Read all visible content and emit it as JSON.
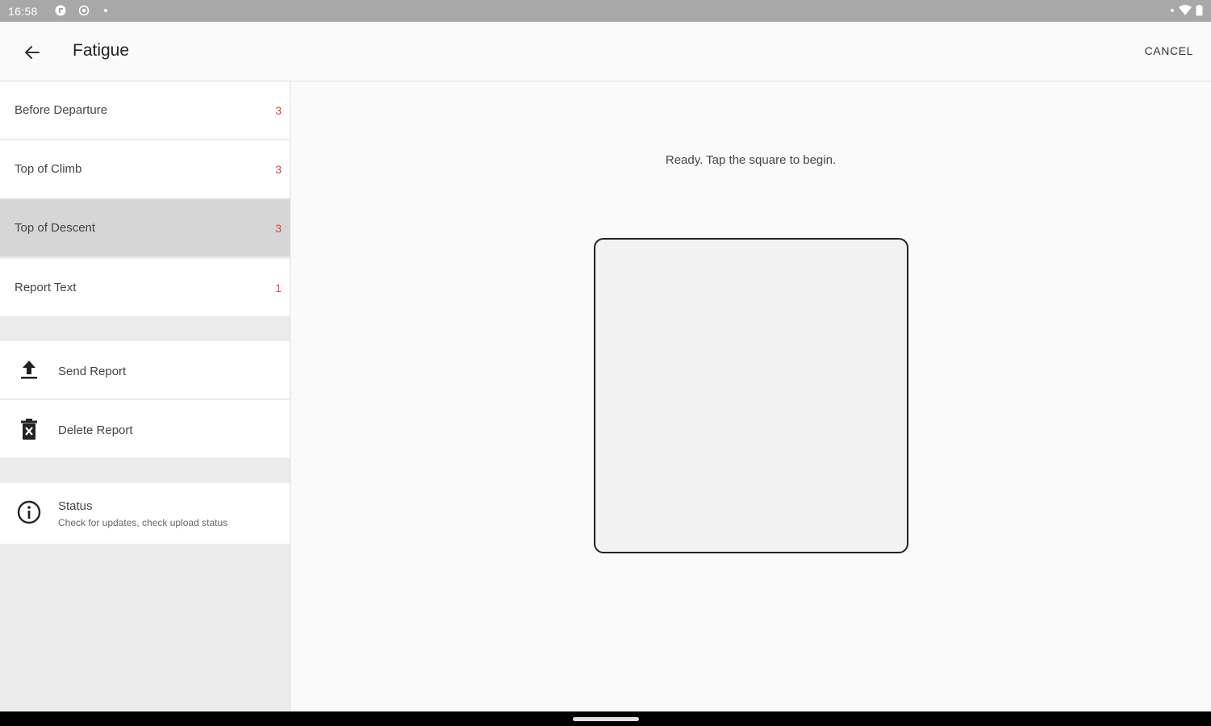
{
  "status_bar": {
    "time": "16:58",
    "icons": [
      "app-icon",
      "settings-circle-icon",
      "dot-icon",
      "wifi-icon",
      "battery-icon"
    ]
  },
  "app_bar": {
    "title": "Fatigue",
    "cancel_label": "CANCEL"
  },
  "sidebar": {
    "items": [
      {
        "label": "Before Departure",
        "count": "3"
      },
      {
        "label": "Top of Climb",
        "count": "3"
      },
      {
        "label": "Top of Descent",
        "count": "3"
      },
      {
        "label": "Report Text",
        "count": "1"
      }
    ],
    "actions": [
      {
        "label": "Send Report",
        "icon": "upload-icon"
      },
      {
        "label": "Delete Report",
        "icon": "delete-icon"
      }
    ],
    "status": {
      "label": "Status",
      "subtitle": "Check for updates, check upload status",
      "icon": "info-icon"
    }
  },
  "main": {
    "instruction": "Ready. Tap the square to begin."
  },
  "colors": {
    "accent_count": "#e04545",
    "selected_bg": "#d6d6d6"
  }
}
